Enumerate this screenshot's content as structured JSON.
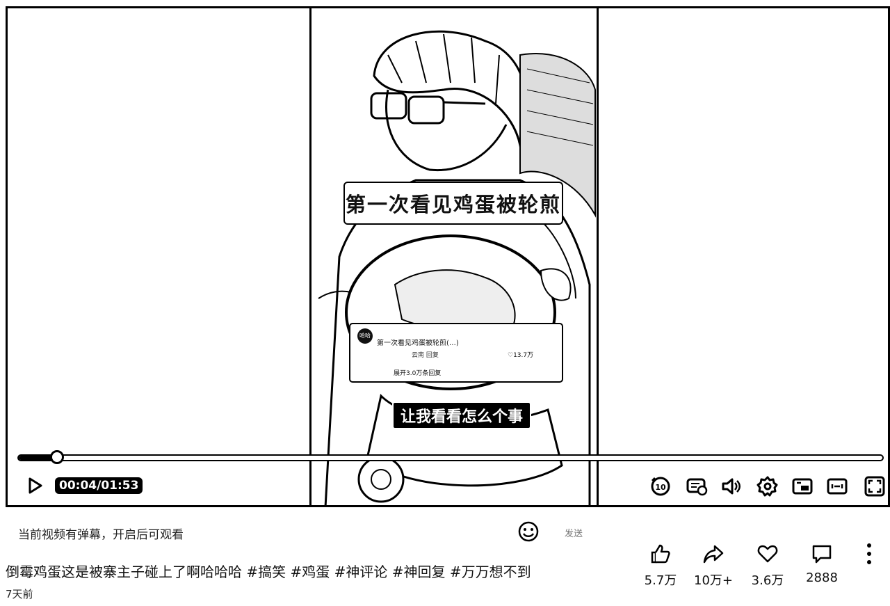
{
  "player": {
    "video_caption_title": "第一次看见鸡蛋被轮煎",
    "comment_card": {
      "avatar_text": "哈哈",
      "text": "第一次看见鸡蛋被轮煎(…)",
      "meta": "云南   回复",
      "likes": "13.7万",
      "expand": "展开3.0万条回复"
    },
    "subtitle_text": "让我看看怎么个事",
    "progress": {
      "fraction": 0.044
    },
    "time_current": "00:04",
    "time_separator": "/",
    "time_total": "01:53",
    "controls": [
      "replay-10-icon",
      "danmaku-settings-icon",
      "volume-icon",
      "settings-gear-icon",
      "picture-in-picture-icon",
      "web-fullscreen-icon",
      "fullscreen-icon"
    ]
  },
  "danmaku": {
    "notice": "当前视频有弹幕，开启后可观看",
    "send_label": "发送"
  },
  "video": {
    "title": "倒霉鸡蛋这是被寨主子碰上了啊哈哈哈 #搞笑 #鸡蛋 #神评论 #神回复 #万万想不到",
    "posted": "7天前"
  },
  "actions": {
    "like": "5.7万",
    "share": "10万+",
    "favorite": "3.6万",
    "comment": "2888"
  }
}
